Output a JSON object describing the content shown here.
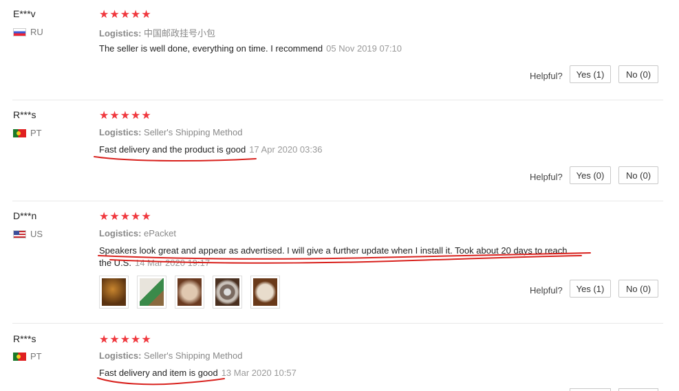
{
  "reviews": [
    {
      "name": "E***v",
      "country": "RU",
      "stars": "★★★★★",
      "logistics_label": "Logistics:",
      "logistics_value": "中国邮政挂号小包",
      "text": "The seller is well done, everything on time. I recommend",
      "date": "05 Nov 2019 07:10",
      "helpful_label": "Helpful?",
      "yes": "Yes (1)",
      "no": "No (0)"
    },
    {
      "name": "R***s",
      "country": "PT",
      "stars": "★★★★★",
      "logistics_label": "Logistics:",
      "logistics_value": "Seller's Shipping Method",
      "text": "Fast delivery and the product is good",
      "date": "17 Apr 2020 03:36",
      "helpful_label": "Helpful?",
      "yes": "Yes (0)",
      "no": "No (0)"
    },
    {
      "name": "D***n",
      "country": "US",
      "stars": "★★★★★",
      "logistics_label": "Logistics:",
      "logistics_value": "ePacket",
      "text_line1": "Speakers look great and appear as advertised. I will give a further update when I install it. Took about 20 days to reach",
      "text_line2": "the U.S.",
      "date": "14 Mar 2020 19:17",
      "helpful_label": "Helpful?",
      "yes": "Yes (1)",
      "no": "No (0)",
      "thumbnails": [
        "photo-1",
        "photo-2",
        "photo-3",
        "photo-4",
        "photo-5"
      ]
    },
    {
      "name": "R***s",
      "country": "PT",
      "stars": "★★★★★",
      "logistics_label": "Logistics:",
      "logistics_value": "Seller's Shipping Method",
      "text": "Fast delivery and item is good",
      "date": "13 Mar 2020 10:57"
    }
  ],
  "colors": {
    "star": "#f0393f",
    "annotation": "#d8201c"
  }
}
